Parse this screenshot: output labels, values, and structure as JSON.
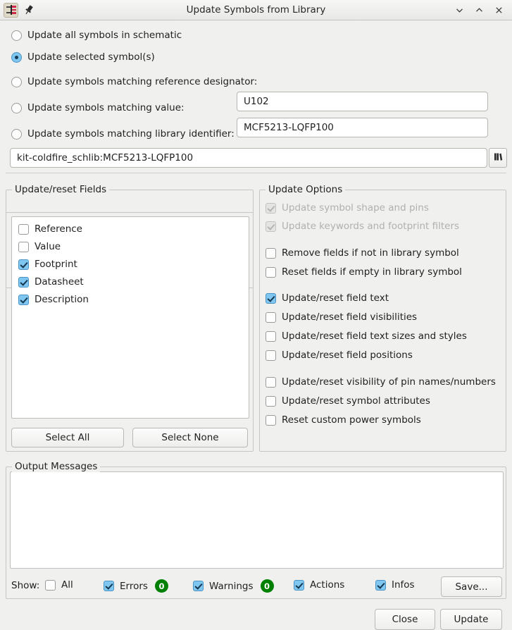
{
  "window": {
    "title": "Update Symbols from Library",
    "app_icon": "kicad-schematic-icon",
    "pin_icon": "pin-icon",
    "minimize_icon": "chevron-down-icon",
    "maximize_icon": "chevron-up-icon",
    "close_icon": "close-icon"
  },
  "scope": {
    "options": [
      {
        "label": "Update all symbols in schematic",
        "selected": false
      },
      {
        "label": "Update selected symbol(s)",
        "selected": true
      },
      {
        "label": "Update symbols matching reference designator:",
        "selected": false
      },
      {
        "label": "Update symbols matching value:",
        "selected": false
      },
      {
        "label": "Update symbols matching library identifier:",
        "selected": false
      }
    ],
    "reference_value": "U102",
    "reference_placeholder": "",
    "value_value": "MCF5213-LQFP100",
    "value_placeholder": "",
    "library_identifier_value": "kit-coldfire_schlib:MCF5213-LQFP100",
    "library_identifier_placeholder": "",
    "library_browse_icon": "library-browser-icon"
  },
  "fields_panel": {
    "title": "Update/reset Fields",
    "items": [
      {
        "label": "Reference",
        "checked": false
      },
      {
        "label": "Value",
        "checked": false
      },
      {
        "label": "Footprint",
        "checked": true
      },
      {
        "label": "Datasheet",
        "checked": true
      },
      {
        "label": "Description",
        "checked": true
      }
    ],
    "select_all_label": "Select All",
    "select_none_label": "Select None"
  },
  "options_panel": {
    "title": "Update Options",
    "groups": [
      {
        "items": [
          {
            "label": "Update symbol shape and pins",
            "checked": true,
            "disabled": true
          },
          {
            "label": "Update keywords and footprint filters",
            "checked": true,
            "disabled": true
          }
        ]
      },
      {
        "items": [
          {
            "label": "Remove fields if not in library symbol",
            "checked": false,
            "disabled": false
          },
          {
            "label": "Reset fields if empty in library symbol",
            "checked": false,
            "disabled": false
          }
        ]
      },
      {
        "items": [
          {
            "label": "Update/reset field text",
            "checked": true,
            "disabled": false
          },
          {
            "label": "Update/reset field visibilities",
            "checked": false,
            "disabled": false
          },
          {
            "label": "Update/reset field text sizes and styles",
            "checked": false,
            "disabled": false
          },
          {
            "label": "Update/reset field positions",
            "checked": false,
            "disabled": false
          }
        ]
      },
      {
        "items": [
          {
            "label": "Update/reset visibility of pin names/numbers",
            "checked": false,
            "disabled": false
          },
          {
            "label": "Update/reset symbol attributes",
            "checked": false,
            "disabled": false
          },
          {
            "label": "Reset custom power symbols",
            "checked": false,
            "disabled": false
          }
        ]
      }
    ]
  },
  "output": {
    "title": "Output Messages",
    "text": "",
    "show_label": "Show:",
    "filters": [
      {
        "label": "All",
        "checked": false,
        "count": null
      },
      {
        "label": "Errors",
        "checked": true,
        "count": "0"
      },
      {
        "label": "Warnings",
        "checked": true,
        "count": "0"
      },
      {
        "label": "Actions",
        "checked": true,
        "count": null
      },
      {
        "label": "Infos",
        "checked": true,
        "count": null
      }
    ],
    "save_label": "Save..."
  },
  "footer": {
    "close_label": "Close",
    "update_label": "Update"
  },
  "colors": {
    "accent_check": "#7fc6f0",
    "badge_green": "#008000",
    "window_bg": "#f0f0ef"
  }
}
